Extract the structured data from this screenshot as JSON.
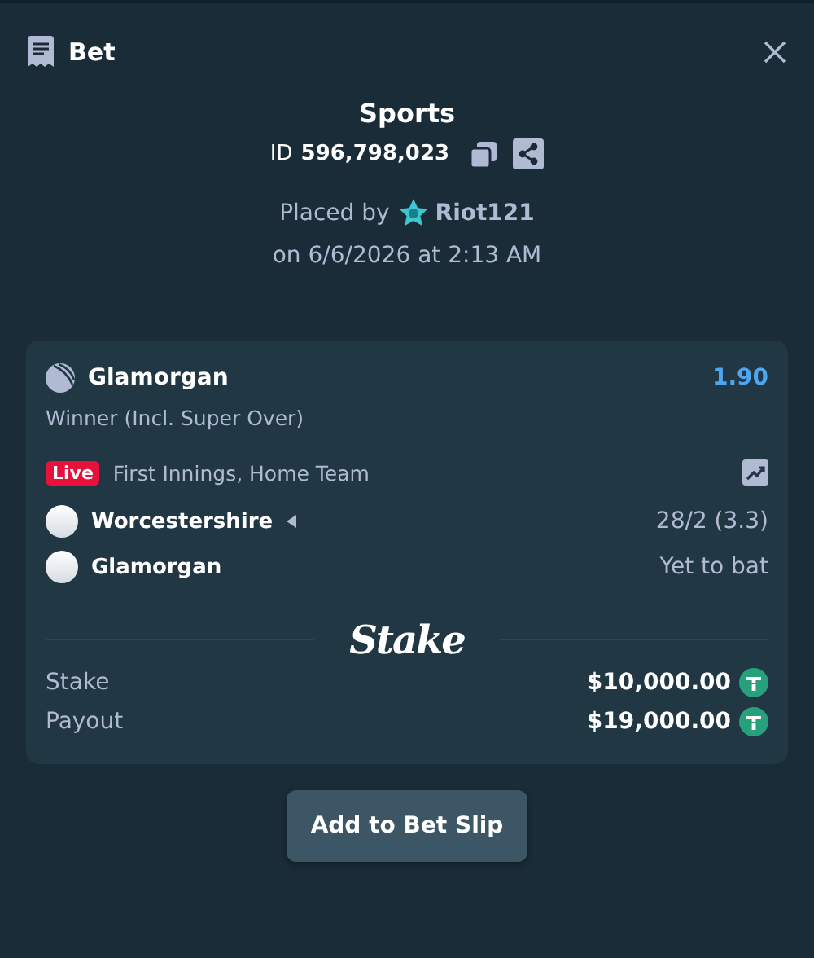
{
  "header": {
    "title": "Bet"
  },
  "bet": {
    "category": "Sports",
    "id_label": "ID",
    "id_value": "596,798,023",
    "placed_by_label": "Placed by",
    "user": "Riot121",
    "placed_on": "on 6/6/2026 at 2:13 AM"
  },
  "selection": {
    "team": "Glamorgan",
    "odds": "1.90",
    "market": "Winner (Incl. Super Over)",
    "live_badge": "Live",
    "period": "First Innings, Home Team",
    "teams": [
      {
        "name": "Worcestershire",
        "batting": true,
        "score": "28/2 (3.3)"
      },
      {
        "name": "Glamorgan",
        "batting": false,
        "score": "Yet to bat"
      }
    ]
  },
  "logo": "Stake",
  "amounts": [
    {
      "label": "Stake",
      "value": "$10,000.00"
    },
    {
      "label": "Payout",
      "value": "$19,000.00"
    }
  ],
  "button": "Add to Bet Slip"
}
